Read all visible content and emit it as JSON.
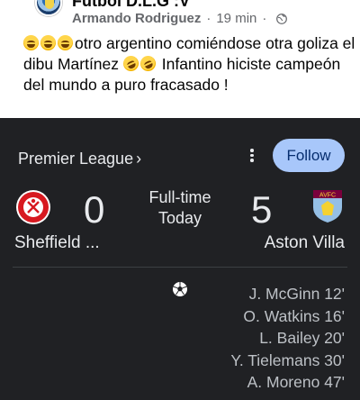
{
  "post": {
    "page_name": "Futbol D.L.G :V",
    "author": "Armando Rodriguez",
    "time": "19 min",
    "separator": "·",
    "text_part1": "otro argentino comiéndose otra goliza el dibu Martínez ",
    "text_part2": " Infantino hiciste campeón del mundo a puro fracasado !",
    "emojis": [
      "laughing-emoji",
      "laughing-emoji",
      "laughing-emoji",
      "rolling-laughing-emoji",
      "rolling-laughing-emoji"
    ]
  },
  "match_card": {
    "league": "Premier League",
    "league_chevron": "›",
    "follow_label": "Follow",
    "status_line1": "Full-time",
    "status_line2": "Today",
    "home": {
      "name": "Sheffield ...",
      "score": "0",
      "crest_color": "#d71920"
    },
    "away": {
      "name": "Aston Villa",
      "score": "5",
      "crest_color": "#95bfe5",
      "crest_text": "AVFC"
    },
    "scorers": [
      "J. McGinn 12'",
      "O. Watkins 16'",
      "L. Bailey 20'",
      "Y. Tielemans 30'",
      "A. Moreno 47'"
    ],
    "colors": {
      "background": "#202124",
      "follow_bg": "#a8c7fa",
      "text": "#e8eaed"
    }
  }
}
